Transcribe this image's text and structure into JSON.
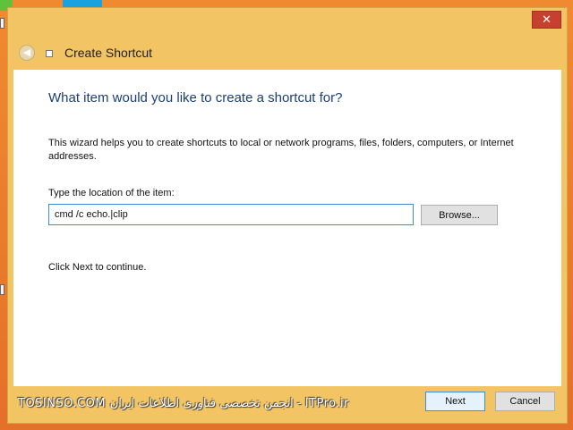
{
  "window": {
    "title": "Create Shortcut",
    "close_glyph": "✕"
  },
  "content": {
    "heading": "What item would you like to create a shortcut for?",
    "description": "This wizard helps you to create shortcuts to local or network programs, files, folders, computers, or Internet addresses.",
    "location_label": "Type the location of the item:",
    "location_value": "cmd /c echo.|clip",
    "browse_label": "Browse...",
    "continue_text": "Click Next to continue."
  },
  "footer": {
    "next_label": "Next",
    "cancel_label": "Cancel"
  },
  "watermark": {
    "text": "TOSINSO.COM انجمن تخصصی فناوری اطلاعات ایران - ITPro.ir"
  },
  "icons": {
    "back": "back-arrow-icon",
    "shortcut": "shortcut-icon",
    "close": "close-icon"
  }
}
